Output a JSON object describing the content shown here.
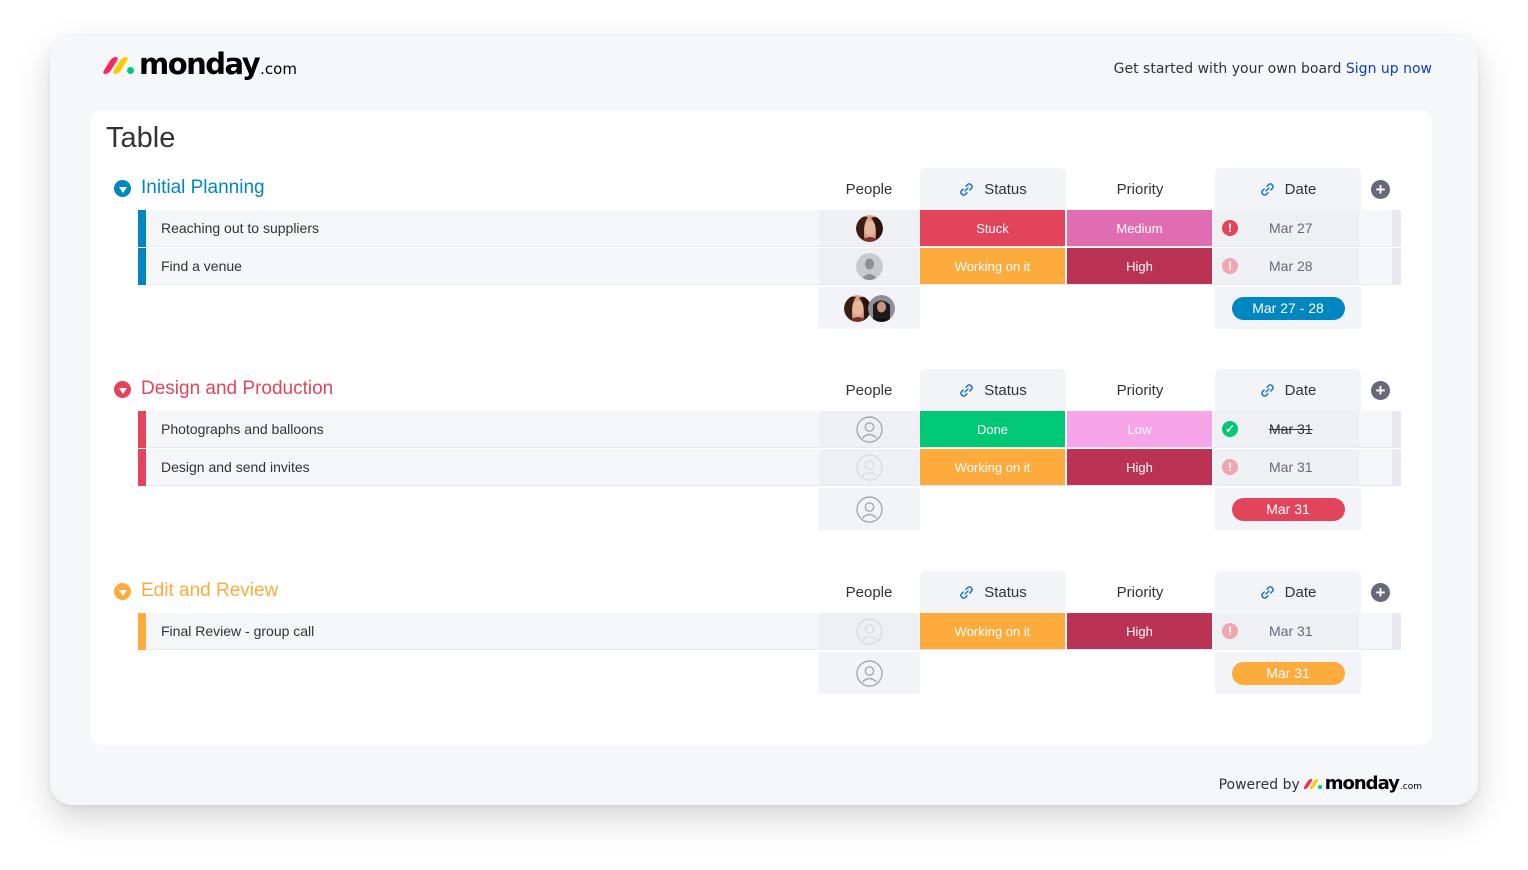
{
  "header": {
    "logo_word": "monday",
    "logo_tld": ".com",
    "signup_text": "Get started with your own board",
    "signup_link": "Sign up now"
  },
  "board": {
    "title": "Table"
  },
  "columns": {
    "people": "People",
    "status": "Status",
    "priority": "Priority",
    "date": "Date"
  },
  "groups": [
    {
      "title": "Initial Planning",
      "color": "#0086c0",
      "rows": [
        {
          "name": "Reaching out to suppliers",
          "people": "avatar-woman-1",
          "status": "Stuck",
          "status_color": "#e2445c",
          "priority": "Medium",
          "priority_color": "#e06db1",
          "date_icon": "alert-icon",
          "date_icon_color": "#e2445c",
          "date": "Mar 27",
          "strike": false
        },
        {
          "name": "Find a venue",
          "people": "avatar-gray",
          "status": "Working on it",
          "status_color": "#fdab3d",
          "priority": "High",
          "priority_color": "#bb3354",
          "date_icon": "alert-icon",
          "date_icon_color": "#f0a6b1",
          "date": "Mar 28",
          "strike": false
        }
      ],
      "summary_people": [
        "avatar-woman-1",
        "avatar-woman-2"
      ],
      "summary_date": "Mar 27 - 28"
    },
    {
      "title": "Design and Production",
      "color": "#e2445c",
      "rows": [
        {
          "name": "Photographs and balloons",
          "people": "empty",
          "status": "Done",
          "status_color": "#00c875",
          "priority": "Low",
          "priority_color": "#f5a5e8",
          "date_icon": "check-icon",
          "date_icon_color": "#00c875",
          "date": "Mar 31",
          "strike": true
        },
        {
          "name": "Design and send invites",
          "people": "empty-light",
          "status": "Working on it",
          "status_color": "#fdab3d",
          "priority": "High",
          "priority_color": "#bb3354",
          "date_icon": "alert-icon",
          "date_icon_color": "#f0a6b1",
          "date": "Mar 31",
          "strike": false
        }
      ],
      "summary_people": [
        "empty"
      ],
      "summary_date": "Mar 31"
    },
    {
      "title": "Edit and Review",
      "color": "#fdab3d",
      "rows": [
        {
          "name": "Final Review - group call",
          "people": "empty-light",
          "status": "Working on it",
          "status_color": "#fdab3d",
          "priority": "High",
          "priority_color": "#bb3354",
          "date_icon": "alert-icon",
          "date_icon_color": "#f0a6b1",
          "date": "Mar 31",
          "strike": false
        }
      ],
      "summary_people": [
        "empty"
      ],
      "summary_date": "Mar 31"
    }
  ],
  "footer": {
    "powered_by": "Powered by",
    "logo_word": "monday",
    "logo_tld": ".com"
  },
  "brand_colors": {
    "red": "#fb275d",
    "yellow": "#ffcb00",
    "green": "#00ca72"
  }
}
